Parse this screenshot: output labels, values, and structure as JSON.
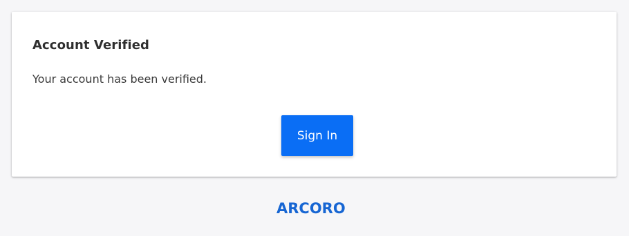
{
  "card": {
    "title": "Account Verified",
    "message": "Your account has been verified.",
    "button_label": "Sign In"
  },
  "footer": {
    "logo_text": "ARCORO"
  },
  "colors": {
    "button": "#0a6ef5",
    "logo": "#1766d3",
    "background": "#f6f6f8"
  }
}
